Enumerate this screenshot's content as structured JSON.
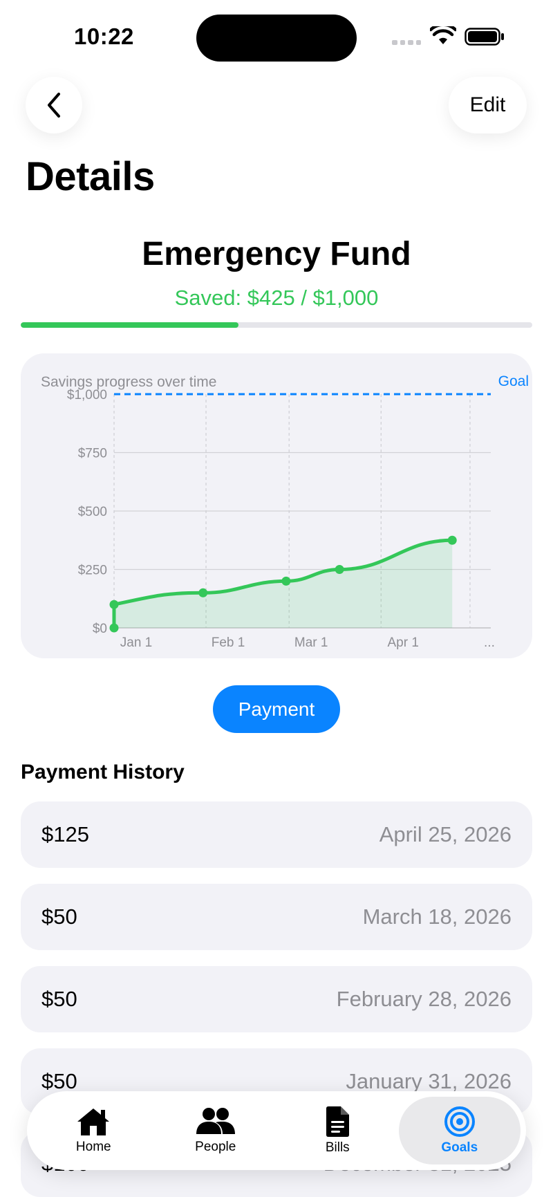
{
  "status_bar": {
    "time": "10:22"
  },
  "nav": {
    "edit_label": "Edit"
  },
  "page_title": "Details",
  "goal": {
    "name": "Emergency Fund",
    "saved_text": "Saved: $425 / $1,000",
    "saved": 425,
    "target": 1000,
    "progress_fraction": 0.425
  },
  "colors": {
    "accent": "#0a84ff",
    "saved_green": "#34c759",
    "card_bg": "#f2f2f7",
    "secondary_text": "#8e8e93"
  },
  "chart_data": {
    "type": "line",
    "caption": "Savings progress over time",
    "goal_label": "Goal",
    "goal_value": 1000,
    "ylim": [
      0,
      1000
    ],
    "y_ticks": [
      0,
      250,
      500,
      750,
      1000
    ],
    "y_tick_labels": [
      "$0",
      "$250",
      "$500",
      "$750",
      "$1,000"
    ],
    "x_tick_labels": [
      "Jan 1",
      "Feb 1",
      "Mar 1",
      "Apr 1",
      "..."
    ],
    "x_tick_dates": [
      "2026-01-01",
      "2026-02-01",
      "2026-03-01",
      "2026-04-01",
      "2026-05-01"
    ],
    "x_range": [
      "2026-01-01",
      "2026-05-08"
    ],
    "area_fill": true,
    "grid": true,
    "series": [
      {
        "x": [
          "2026-01-01",
          "2026-01-01",
          "2026-01-31",
          "2026-02-28",
          "2026-03-18",
          "2026-04-25"
        ],
        "y": [
          0,
          100,
          150,
          200,
          250,
          375
        ]
      }
    ]
  },
  "payment_button_label": "Payment",
  "history": {
    "title": "Payment History",
    "rows": [
      {
        "amount": "$125",
        "date": "April 25, 2026"
      },
      {
        "amount": "$50",
        "date": "March 18, 2026"
      },
      {
        "amount": "$50",
        "date": "February 28, 2026"
      },
      {
        "amount": "$50",
        "date": "January 31, 2026"
      },
      {
        "amount": "$100",
        "date": "December 31, 2025"
      }
    ]
  },
  "tabs": [
    {
      "label": "Home",
      "icon": "house-icon",
      "active": false
    },
    {
      "label": "People",
      "icon": "people-icon",
      "active": false
    },
    {
      "label": "Bills",
      "icon": "document-icon",
      "active": false
    },
    {
      "label": "Goals",
      "icon": "target-icon",
      "active": true
    }
  ]
}
